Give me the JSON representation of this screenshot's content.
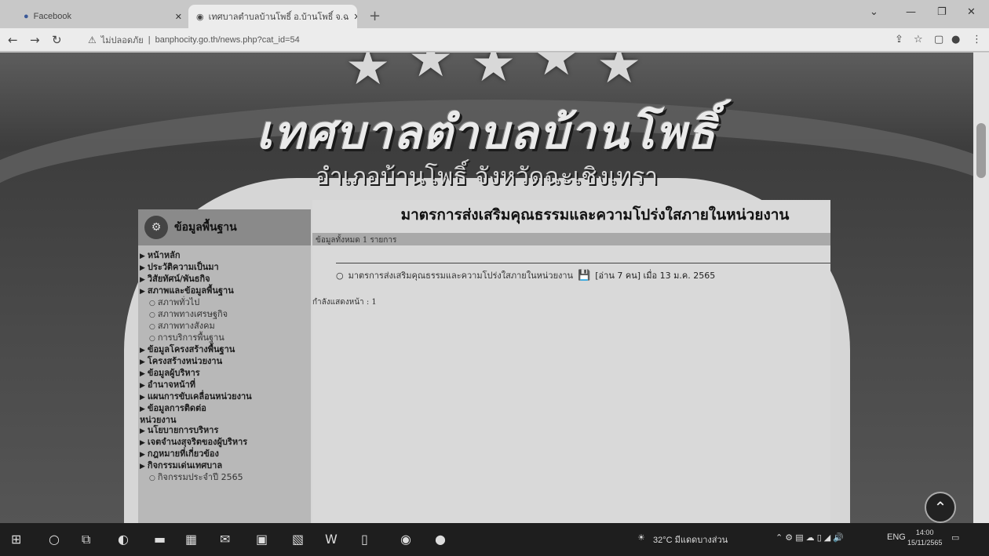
{
  "browser": {
    "tab1_title": "Facebook",
    "tab2_title": "เทศบาลตำบลบ้านโพธิ์ อ.บ้านโพธิ์ จ.ฉ",
    "address_warning": "ไม่ปลอดภัย",
    "url": "banphocity.go.th/news.php?cat_id=54"
  },
  "site": {
    "title": "เทศบาลตำบลบ้านโพธิ์",
    "subtitle": "อำเภอบ้านโพธิ์ จังหวัดฉะเชิงเทรา"
  },
  "sidebar": {
    "header": "ข้อมูลพื้นฐาน",
    "items": [
      {
        "label": "หน้าหลัก",
        "type": "main"
      },
      {
        "label": "ประวัติความเป็นมา",
        "type": "main"
      },
      {
        "label": "วิสัยทัศน์/พันธกิจ",
        "type": "main"
      },
      {
        "label": "สภาพและข้อมูลพื้นฐาน",
        "type": "main"
      },
      {
        "label": "สภาพทั่วไป",
        "type": "sub"
      },
      {
        "label": "สภาพทางเศรษฐกิจ",
        "type": "sub"
      },
      {
        "label": "สภาพทางสังคม",
        "type": "sub"
      },
      {
        "label": "การบริการพื้นฐาน",
        "type": "sub"
      },
      {
        "label": "ข้อมูลโครงสร้างพื้นฐาน",
        "type": "main"
      },
      {
        "label": "โครงสร้างหน่วยงาน",
        "type": "main"
      },
      {
        "label": "ข้อมูลผู้บริหาร",
        "type": "main"
      },
      {
        "label": "อำนาจหน้าที่",
        "type": "main"
      },
      {
        "label": "แผนการขับเคลื่อนหน่วยงาน",
        "type": "main"
      },
      {
        "label": "ข้อมูลการติดต่อ",
        "type": "main"
      },
      {
        "label": "หน่วยงาน",
        "type": "wrap"
      },
      {
        "label": "นโยบายการบริหาร",
        "type": "main"
      },
      {
        "label": "เจตจำนงสุจริตของผู้บริหาร",
        "type": "main"
      },
      {
        "label": "กฎหมายที่เกี่ยวข้อง",
        "type": "main"
      },
      {
        "label": "กิจกรรมเด่นเทศบาล",
        "type": "main"
      },
      {
        "label": "กิจกรรมประจำปี 2565",
        "type": "sub"
      }
    ]
  },
  "main": {
    "heading": "มาตรการส่งเสริมคุณธรรมและความโปร่งใสภายในหน่วยงาน",
    "count_text": "ข้อมูลทั้งหมด 1 รายการ",
    "news_title": "มาตรการส่งเสริมคุณธรรมและความโปร่งใสภายในหน่วยงาน",
    "news_meta": "[อ่าน 7 คน] เมื่อ 13 ม.ค. 2565",
    "pager_text": "กำลังแสดงหน้า : 1"
  },
  "taskbar": {
    "weather": "32°C มีแดดบางส่วน",
    "lang": "ENG",
    "time": "14:00",
    "date": "15/11/2565"
  }
}
